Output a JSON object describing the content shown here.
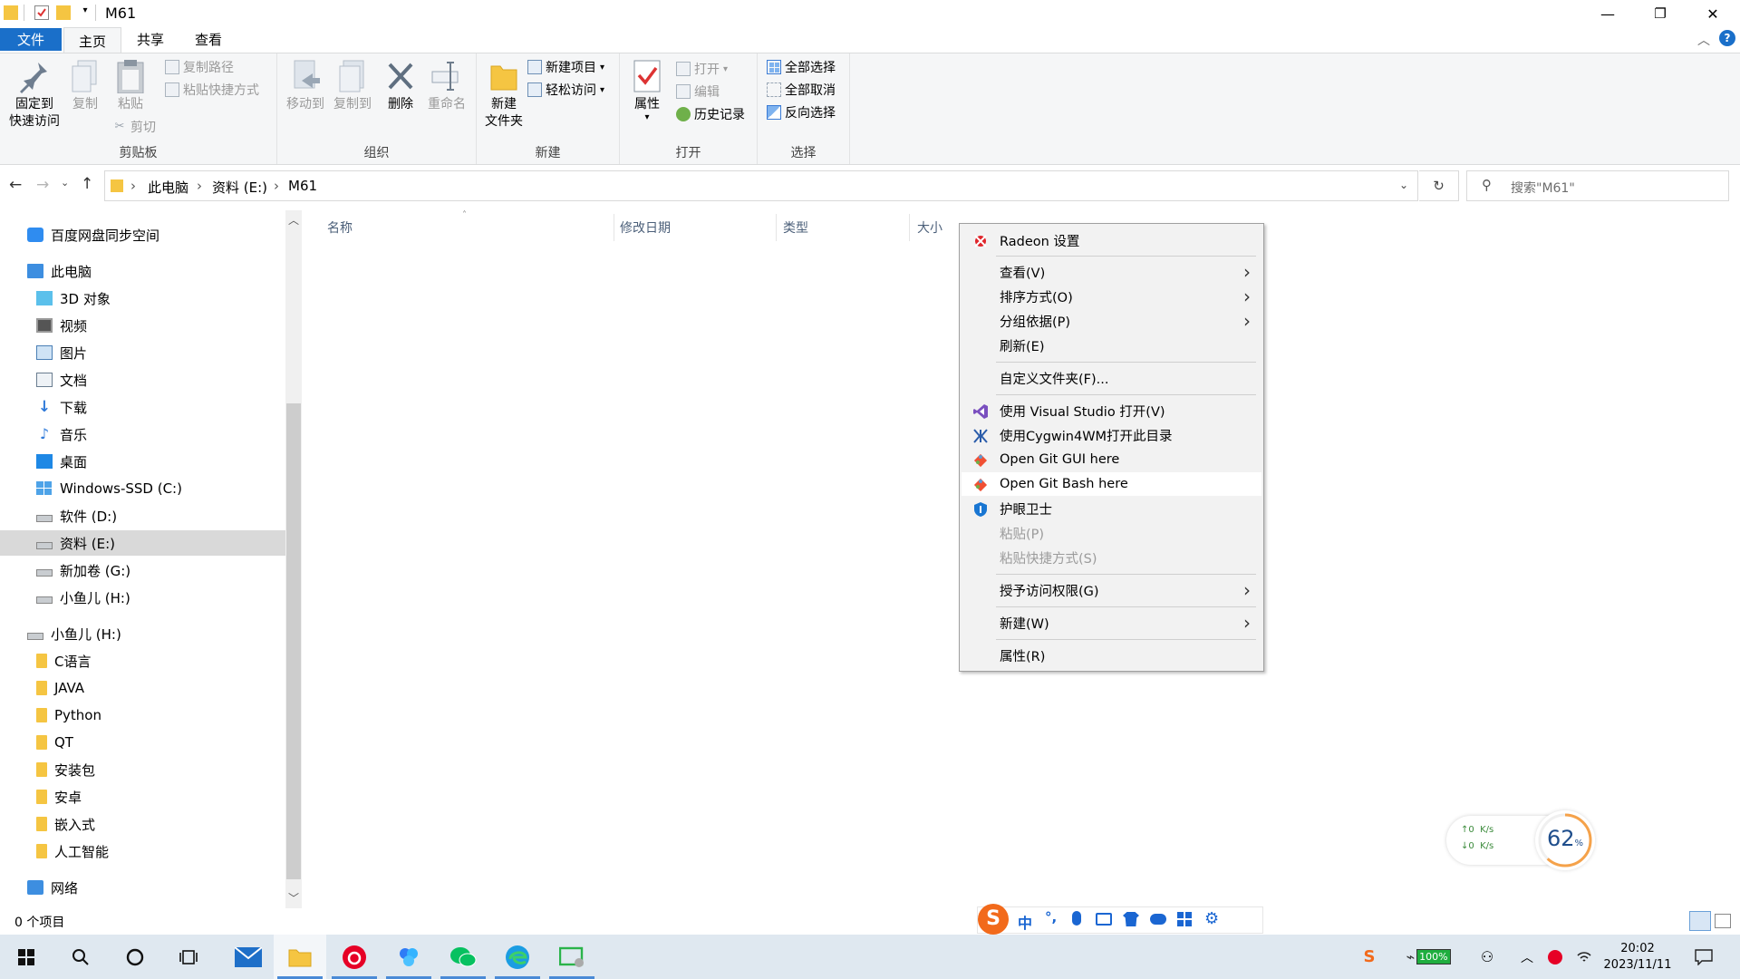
{
  "window": {
    "title": "M61",
    "minimize_glyph": "—",
    "maximize_glyph": "❐",
    "close_glyph": "✕"
  },
  "ribbon_tabs": {
    "file": "文件",
    "home": "主页",
    "share": "共享",
    "view": "查看"
  },
  "ribbon": {
    "clipboard": {
      "pin_l1": "固定到",
      "pin_l2": "快速访问",
      "copy": "复制",
      "paste": "粘贴",
      "copy_path": "复制路径",
      "paste_shortcut": "粘贴快捷方式",
      "cut": "剪切",
      "label": "剪贴板"
    },
    "organize": {
      "move_to": "移动到",
      "copy_to": "复制到",
      "delete": "删除",
      "rename": "重命名",
      "label": "组织"
    },
    "new": {
      "new_folder_l1": "新建",
      "new_folder_l2": "文件夹",
      "new_item": "新建项目",
      "easy_access": "轻松访问",
      "label": "新建"
    },
    "open": {
      "properties": "属性",
      "open": "打开",
      "edit": "编辑",
      "history": "历史记录",
      "label": "打开"
    },
    "select": {
      "select_all": "全部选择",
      "select_none": "全部取消",
      "invert": "反向选择",
      "label": "选择"
    }
  },
  "address": {
    "crumbs": [
      "此电脑",
      "资料 (E:)",
      "M61"
    ],
    "sep": "›",
    "search_placeholder": "搜索\"M61\""
  },
  "nav_pane": {
    "baidu": "百度网盘同步空间",
    "this_pc": "此电脑",
    "pc_items": [
      "3D 对象",
      "视频",
      "图片",
      "文档",
      "下载",
      "音乐",
      "桌面",
      "Windows-SSD (C:)",
      "软件 (D:)",
      "资料 (E:)",
      "新加卷 (G:)",
      "小鱼儿 (H:)"
    ],
    "drive_h": "小鱼儿 (H:)",
    "h_folders": [
      "C语言",
      "JAVA",
      "Python",
      "QT",
      "安装包",
      "安卓",
      "嵌入式",
      "人工智能"
    ],
    "network": "网络"
  },
  "columns": {
    "name": "名称",
    "modified": "修改日期",
    "type": "类型",
    "size": "大小"
  },
  "status": {
    "item_count": "0 个项目"
  },
  "context_menu": {
    "items": [
      {
        "label": "Radeon 设置",
        "icon": "radeon-icon"
      },
      {
        "label": "查看(V)",
        "submenu": true
      },
      {
        "label": "排序方式(O)",
        "submenu": true
      },
      {
        "label": "分组依据(P)",
        "submenu": true
      },
      {
        "label": "刷新(E)"
      },
      {
        "label": "自定义文件夹(F)..."
      },
      {
        "label": "使用 Visual Studio 打开(V)",
        "icon": "visual-studio-icon"
      },
      {
        "label": "使用Cygwin4WM打开此目录",
        "icon": "cygwin-icon"
      },
      {
        "label": "Open Git GUI here",
        "icon": "git-icon"
      },
      {
        "label": "Open Git Bash here",
        "icon": "git-icon",
        "highlighted": true
      },
      {
        "label": "护眼卫士",
        "icon": "eye-guard-icon"
      },
      {
        "label": "粘贴(P)",
        "disabled": true
      },
      {
        "label": "粘贴快捷方式(S)",
        "disabled": true
      },
      {
        "label": "授予访问权限(G)",
        "submenu": true
      },
      {
        "label": "新建(W)",
        "submenu": true
      },
      {
        "label": "属性(R)"
      }
    ],
    "arrow": "›"
  },
  "ime": {
    "mode": "中",
    "punct": "°,"
  },
  "net_widget": {
    "up": "↑0  K/s",
    "down": "↓0  K/s",
    "percent": "62",
    "percent_sign": "%"
  },
  "taskbar": {
    "battery": "100%",
    "time": "20:02",
    "date": "2023/11/11"
  },
  "colors": {
    "accent": "#1a6fc9",
    "taskbar": "#dfe8f0",
    "menu_bg": "#f2f2f2",
    "progress_ring": "#f5a24a"
  }
}
